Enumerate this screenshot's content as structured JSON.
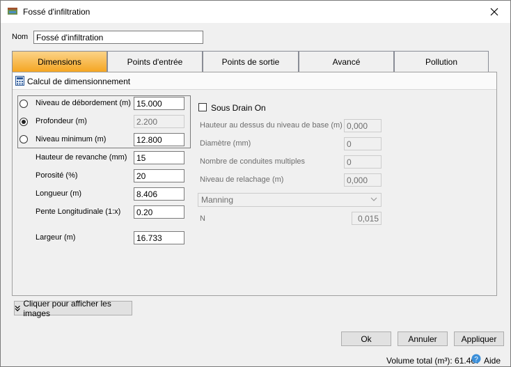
{
  "window": {
    "title": "Fossé d'infiltration",
    "app_icon": "basin-app-icon"
  },
  "name_label": "Nom",
  "name_value": "Fossé d'infiltration",
  "tabs": [
    {
      "label": "Dimensions",
      "active": true
    },
    {
      "label": "Points d'entrée"
    },
    {
      "label": "Points de sortie"
    },
    {
      "label": "Avancé"
    },
    {
      "label": "Pollution"
    }
  ],
  "section_title": "Calcul de dimensionnement",
  "radios": [
    {
      "label": "Niveau de débordement (m)",
      "value": "15.000",
      "selected": false
    },
    {
      "label": "Profondeur (m)",
      "value": "2.200",
      "selected": true
    },
    {
      "label": "Niveau minimum (m)",
      "value": "12.800",
      "selected": false
    }
  ],
  "fields": [
    {
      "label": "Hauteur de revanche (mm)",
      "value": "15"
    },
    {
      "label": "Porosité (%)",
      "value": "20"
    },
    {
      "label": "Longueur (m)",
      "value": "8.406"
    },
    {
      "label": "Pente Longitudinale (1:x)",
      "value": "0.20"
    },
    {
      "label": "Largeur (m)",
      "value": "16.733"
    }
  ],
  "drain": {
    "checkbox_label": "Sous Drain On",
    "checked": false,
    "fields": [
      {
        "label": "Hauteur au dessus du niveau de base (m)",
        "value": "0,000"
      },
      {
        "label": "Diamètre (mm)",
        "value": "0"
      },
      {
        "label": "Nombre de conduites multiples",
        "value": "0"
      },
      {
        "label": "Niveau de relachage (m)",
        "value": "0,000"
      }
    ],
    "method_select": "Manning",
    "n_label": "N",
    "n_value": "0,015"
  },
  "show_images_button": "Cliquer pour afficher les images",
  "buttons": {
    "ok": "Ok",
    "cancel": "Annuler",
    "apply": "Appliquer"
  },
  "status": {
    "volume": "Volume total (m³): 61.467",
    "help": "Aide"
  },
  "colors": {
    "active_tab": "#f5a623",
    "panel_bg": "#f0f0f0"
  }
}
